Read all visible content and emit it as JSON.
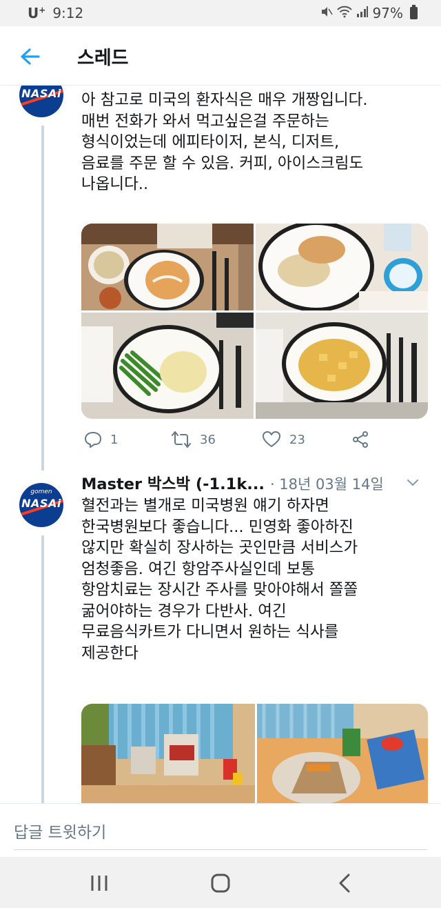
{
  "status_bar": {
    "carrier": "U",
    "carrier_plus": "+",
    "time": "9:12",
    "battery": "97%"
  },
  "header": {
    "title": "스레드"
  },
  "tweets": [
    {
      "text": "아 참고로 미국의 환자식은 매우 개짱입니다.\n매번 전화가 와서 먹고싶은걸 주문하는\n형식이었는데 에피타이저, 본식, 디저트,\n음료를 주문 할 수 있음. 커피, 아이스크림도\n나옵니다..",
      "replies": "1",
      "retweets": "36",
      "likes": "23"
    },
    {
      "author": "Master 박스박 (-1.1k...",
      "date": "· 18년 03월 14일",
      "text": "혈전과는 별개로 미국병원 얘기 하자면\n한국병원보다 좋습니다... 민영화 좋아하진\n않지만 확실히 장사하는 곳인만큼 서비스가\n엄청좋음. 여긴 항암주사실인데 보통\n항암치료는 장시간 주사를 맞아야해서 쫄쫄\n굶어야하는 경우가 다반사. 여긴\n무료음식카트가 다니면서 원하는 식사를\n제공한다"
    }
  ],
  "avatar": {
    "top_text": "gomen",
    "main_text": "NASAi"
  },
  "reply_bar": {
    "placeholder": "답글 트윗하기"
  },
  "colors": {
    "accent": "#1da1f2",
    "text": "#14171a",
    "muted": "#657786"
  }
}
